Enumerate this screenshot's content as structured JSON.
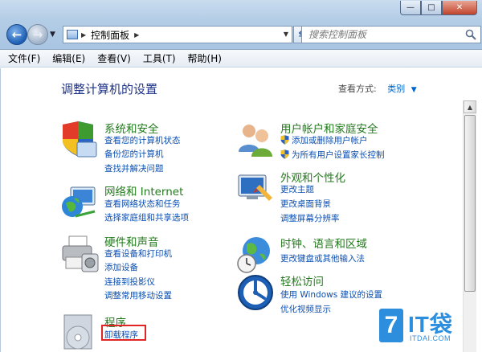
{
  "address": {
    "crumb": "控制面板",
    "search_placeholder": "搜索控制面板"
  },
  "window_buttons": {
    "minimize": "—",
    "maximize": "□",
    "close": "✕"
  },
  "menu": [
    "文件(F)",
    "编辑(E)",
    "查看(V)",
    "工具(T)",
    "帮助(H)"
  ],
  "page": {
    "heading": "调整计算机的设置",
    "view_by_label": "查看方式:",
    "view_by_value": "类别"
  },
  "categories": {
    "system": {
      "title": "系统和安全",
      "links": [
        "查看您的计算机状态",
        "备份您的计算机",
        "查找并解决问题"
      ]
    },
    "network": {
      "title": "网络和 Internet",
      "links": [
        "查看网络状态和任务",
        "选择家庭组和共享选项"
      ]
    },
    "hardware": {
      "title": "硬件和声音",
      "links": [
        "查看设备和打印机",
        "添加设备",
        "连接到投影仪",
        "调整常用移动设置"
      ]
    },
    "programs": {
      "title": "程序",
      "links": [
        "卸载程序"
      ]
    },
    "users": {
      "title": "用户帐户和家庭安全",
      "links": [
        "添加或删除用户帐户",
        "为所有用户设置家长控制"
      ]
    },
    "appearance": {
      "title": "外观和个性化",
      "links": [
        "更改主题",
        "更改桌面背景",
        "调整屏幕分辨率"
      ]
    },
    "clock": {
      "title": "时钟、语言和区域",
      "links": [
        "更改键盘或其他输入法"
      ]
    },
    "access": {
      "title": "轻松访问",
      "links": [
        "使用 Windows 建议的设置",
        "优化视频显示"
      ]
    }
  },
  "watermark": {
    "mark": "7",
    "brand": "IT袋",
    "domain": "ITDAI.COM"
  },
  "colors": {
    "category_title": "#247a1e",
    "link": "#0a4fb3",
    "heading": "#1e3287",
    "highlight": "#e12424"
  }
}
